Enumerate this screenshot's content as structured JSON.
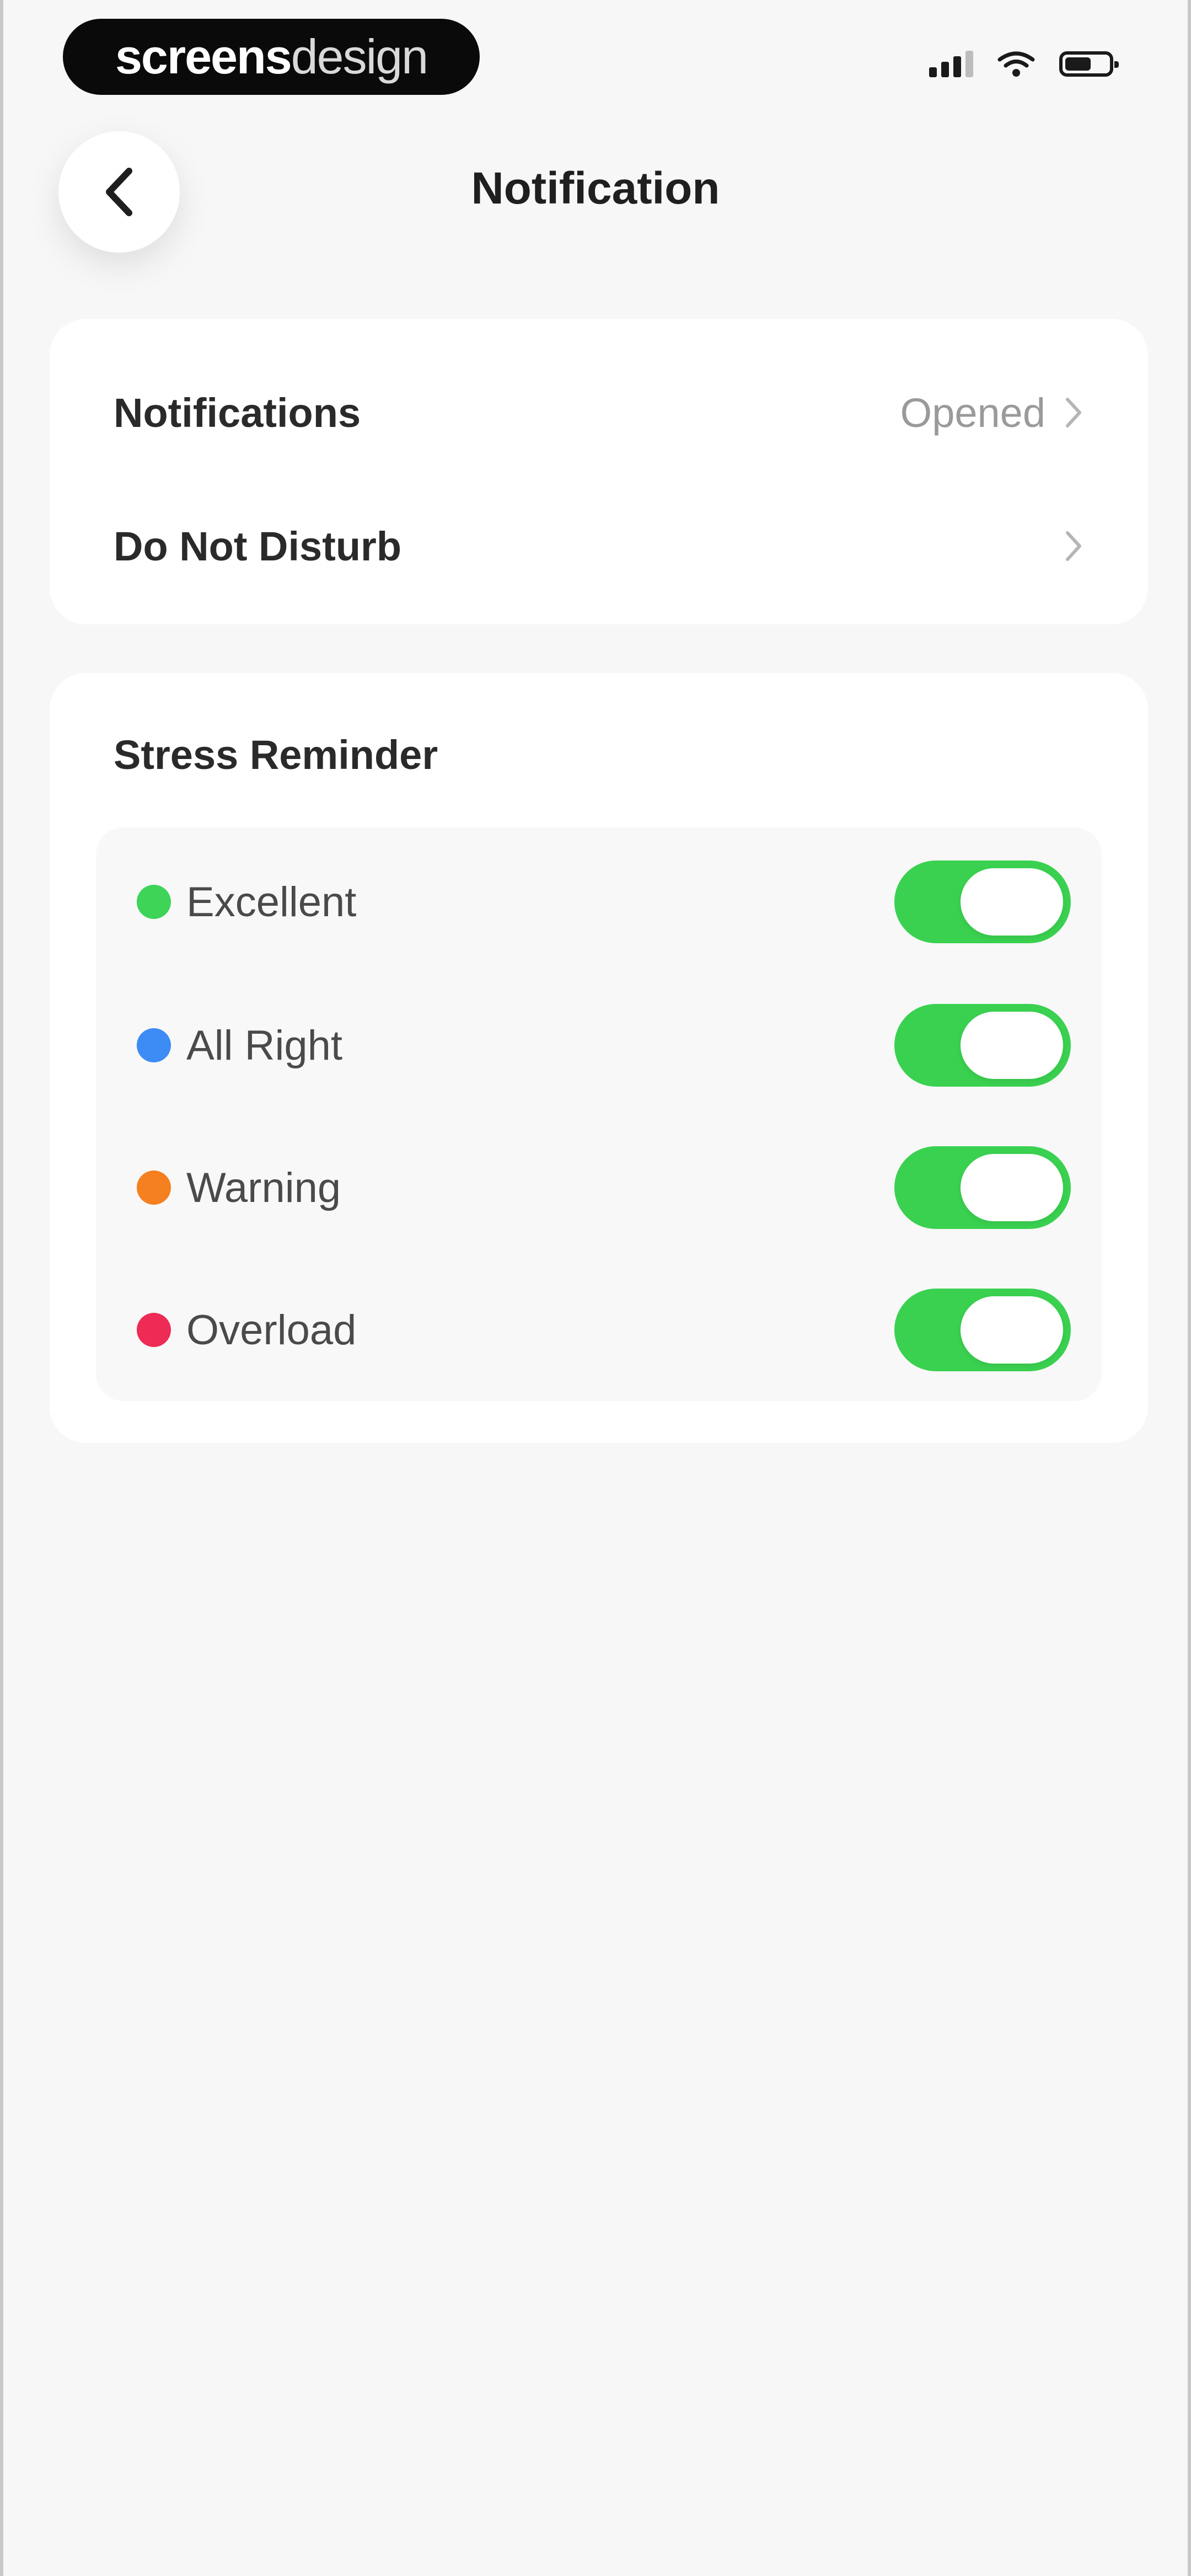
{
  "status_bar": {
    "brand_strong": "screens",
    "brand_light": "design",
    "battery_level": 0.6
  },
  "header": {
    "title": "Notification"
  },
  "settings": {
    "notifications_label": "Notifications",
    "notifications_value": "Opened",
    "dnd_label": "Do Not Disturb"
  },
  "stress_reminder": {
    "title": "Stress Reminder",
    "items": [
      {
        "label": "Excellent",
        "color": "#3dd457",
        "enabled": true
      },
      {
        "label": "All Right",
        "color": "#3d8bf5",
        "enabled": true
      },
      {
        "label": "Warning",
        "color": "#f5801f",
        "enabled": true
      },
      {
        "label": "Overload",
        "color": "#ee2b55",
        "enabled": true
      }
    ]
  },
  "colors": {
    "toggle_on": "#3ad150",
    "background": "#f7f7f7",
    "card": "#ffffff"
  }
}
